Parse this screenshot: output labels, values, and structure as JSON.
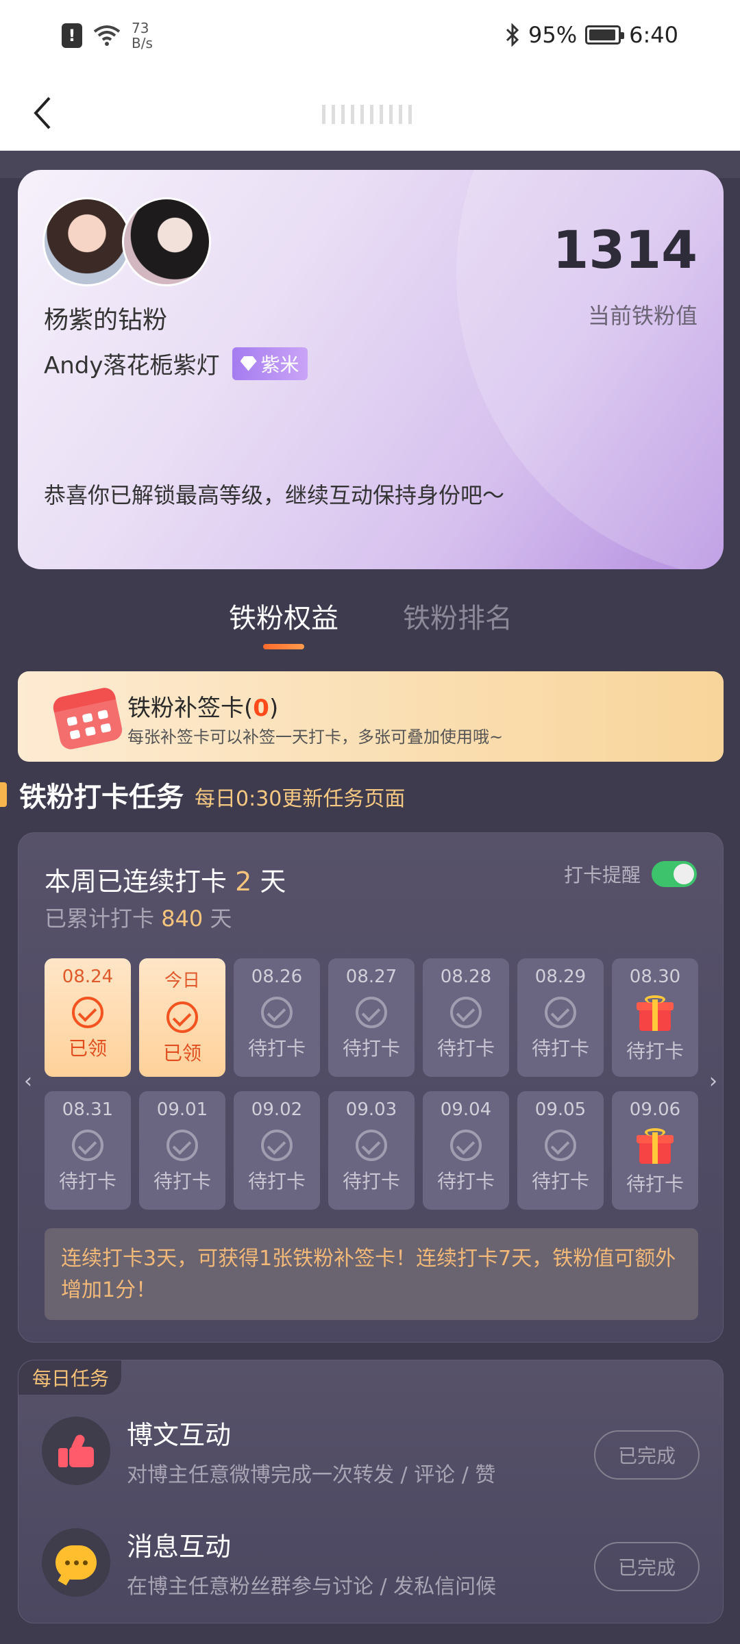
{
  "status_bar": {
    "speed_value": "73",
    "speed_unit": "B/s",
    "battery": "95%",
    "time": "6:40",
    "battery_level": 0.95
  },
  "profile": {
    "fan_title": "杨紫的钻粉",
    "username": "Andy落花栀紫灯",
    "badge": "紫米",
    "score": "1314",
    "score_label": "当前铁粉值",
    "message": "恭喜你已解锁最高等级，继续互动保持身份吧～"
  },
  "tabs": [
    {
      "label": "铁粉权益",
      "active": true
    },
    {
      "label": "铁粉排名",
      "active": false
    }
  ],
  "makeup_card": {
    "title": "铁粉补签卡",
    "count": "0",
    "desc": "每张补签卡可以补签一天打卡，多张可叠加使用哦~"
  },
  "checkin_section": {
    "title": "铁粉打卡任务",
    "subtitle": "每日0:30更新任务页面"
  },
  "checkin": {
    "streak_prefix": "本周已连续打卡 ",
    "streak_days": "2",
    "streak_suffix": " 天",
    "total_prefix": "已累计打卡 ",
    "total_days": "840",
    "total_suffix": " 天",
    "reminder_label": "打卡提醒",
    "reminder_on": true,
    "days": [
      {
        "date": "08.24",
        "status": "已领",
        "type": "done"
      },
      {
        "date": "今日",
        "status": "已领",
        "type": "done"
      },
      {
        "date": "08.26",
        "status": "待打卡",
        "type": "pending"
      },
      {
        "date": "08.27",
        "status": "待打卡",
        "type": "pending"
      },
      {
        "date": "08.28",
        "status": "待打卡",
        "type": "pending"
      },
      {
        "date": "08.29",
        "status": "待打卡",
        "type": "pending"
      },
      {
        "date": "08.30",
        "status": "待打卡",
        "type": "gift"
      },
      {
        "date": "08.31",
        "status": "待打卡",
        "type": "pending"
      },
      {
        "date": "09.01",
        "status": "待打卡",
        "type": "pending"
      },
      {
        "date": "09.02",
        "status": "待打卡",
        "type": "pending"
      },
      {
        "date": "09.03",
        "status": "待打卡",
        "type": "pending"
      },
      {
        "date": "09.04",
        "status": "待打卡",
        "type": "pending"
      },
      {
        "date": "09.05",
        "status": "待打卡",
        "type": "pending"
      },
      {
        "date": "09.06",
        "status": "待打卡",
        "type": "gift"
      }
    ],
    "note": "连续打卡3天，可获得1张铁粉补签卡！连续打卡7天，铁粉值可额外增加1分！"
  },
  "daily_tasks": {
    "tag": "每日任务",
    "items": [
      {
        "title": "博文互动",
        "desc": "对博主任意微博完成一次转发 / 评论 / 赞",
        "button": "已完成",
        "icon": "thumbs-up-icon"
      },
      {
        "title": "消息互动",
        "desc": "在博主任意粉丝群参与讨论 / 发私信问候",
        "button": "已完成",
        "icon": "chat-bubble-icon"
      }
    ]
  },
  "colors": {
    "accent": "#ff6a2c",
    "gold": "#f7c57c",
    "toggle_on": "#3cc36b",
    "bg": "#3e3b4f"
  }
}
